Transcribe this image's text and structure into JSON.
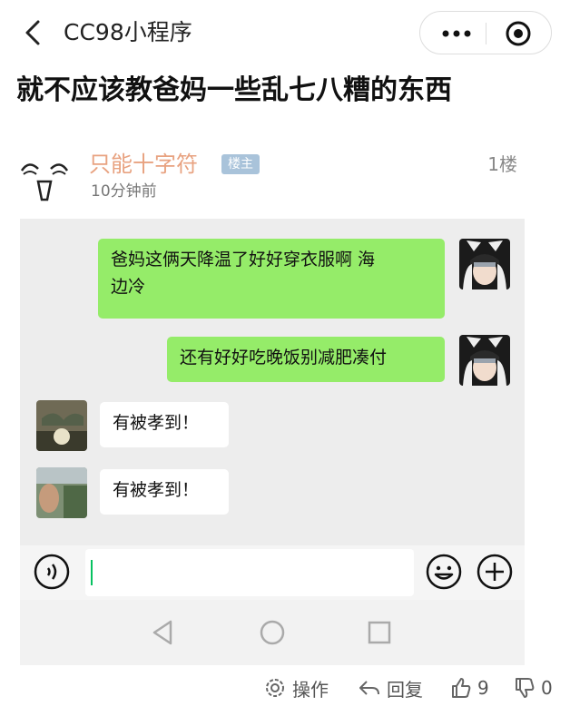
{
  "nav": {
    "title": "CC98小程序"
  },
  "post": {
    "title": "就不应该教爸妈一些乱七八糟的东西"
  },
  "author": {
    "name": "只能十字符",
    "badge": "楼主",
    "time": "10分钟前",
    "floor": "1楼"
  },
  "chat": {
    "messages": [
      {
        "side": "right",
        "line1": "爸妈这俩天降温了好好穿衣服啊 海",
        "line2": "边冷"
      },
      {
        "side": "right",
        "text": "还有好好吃晚饭别减肥凑付"
      },
      {
        "side": "left",
        "text": "有被孝到！"
      },
      {
        "side": "left",
        "text": "有被孝到！"
      }
    ],
    "input_value": ""
  },
  "actions": {
    "operate": "操作",
    "reply": "回复",
    "likes": "9",
    "dislikes": "0"
  },
  "colors": {
    "bubble_green": "#95ec69",
    "author_name": "#e8a280",
    "badge": "#a9c3da",
    "chat_bg": "#ededed"
  }
}
